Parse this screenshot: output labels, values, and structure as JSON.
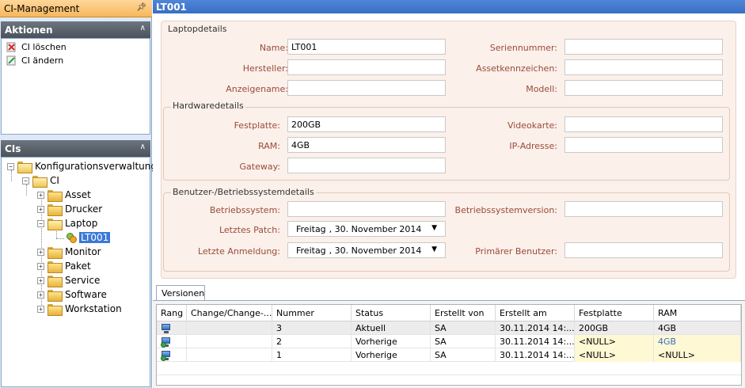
{
  "app": {
    "title": "CI-Management"
  },
  "actions_panel": {
    "title": "Aktionen",
    "items": [
      {
        "label": "CI löschen",
        "icon": "delete-icon"
      },
      {
        "label": "CI ändern",
        "icon": "edit-icon"
      }
    ]
  },
  "cis_panel": {
    "title": "CIs",
    "tree": {
      "root": "Konfigurationsverwaltung",
      "ci": "CI",
      "children": [
        "Asset",
        "Drucker",
        "Laptop",
        "Monitor",
        "Paket",
        "Service",
        "Software",
        "Workstation"
      ],
      "laptop_child": "LT001"
    }
  },
  "header": {
    "title": "LT001"
  },
  "laptopdetails": {
    "group_title": "Laptopdetails",
    "name_label": "Name:",
    "name_value": "LT001",
    "seriennummer_label": "Seriennummer:",
    "seriennummer_value": "",
    "hersteller_label": "Hersteller:",
    "hersteller_value": "",
    "assetkennzeichen_label": "Assetkennzeichen:",
    "assetkennzeichen_value": "",
    "anzeigename_label": "Anzeigename:",
    "anzeigename_value": "",
    "modell_label": "Modell:",
    "modell_value": ""
  },
  "hardwaredetails": {
    "group_title": "Hardwaredetails",
    "festplatte_label": "Festplatte:",
    "festplatte_value": "200GB",
    "videokarte_label": "Videokarte:",
    "videokarte_value": "",
    "ram_label": "RAM:",
    "ram_value": "4GB",
    "ip_label": "IP-Adresse:",
    "ip_value": "",
    "gateway_label": "Gateway:",
    "gateway_value": ""
  },
  "benutzerdetails": {
    "group_title": "Benutzer-/Betriebssystemdetails",
    "betriebssystem_label": "Betriebssystem:",
    "betriebssystem_value": "",
    "version_label": "Betriebssystemversion:",
    "version_value": "",
    "patch_label": "Letztes Patch:",
    "patch_day": "Freitag",
    "patch_date": ", 30. November 2014",
    "anmeldung_label": "Letzte Anmeldung:",
    "anmeldung_day": "Freitag",
    "anmeldung_date": ", 30. November 2014",
    "benutzer_label": "Primärer Benutzer:",
    "benutzer_value": ""
  },
  "versions": {
    "tab_label": "Versionen",
    "columns": [
      "Rang",
      "Change/Change-...",
      "Nummer",
      "Status",
      "Erstellt von",
      "Erstellt am",
      "Festplatte",
      "RAM"
    ],
    "rows": [
      {
        "nummer": "3",
        "status": "Aktuell",
        "erstellt_von": "SA",
        "erstellt_am": "30.11.2014 14:...",
        "festplatte": "200GB",
        "ram": "4GB"
      },
      {
        "nummer": "2",
        "status": "Vorherige",
        "erstellt_von": "SA",
        "erstellt_am": "30.11.2014 14:...",
        "festplatte": "<NULL>",
        "ram": "4GB"
      },
      {
        "nummer": "1",
        "status": "Vorherige",
        "erstellt_von": "SA",
        "erstellt_am": "30.11.2014 14:...",
        "festplatte": "<NULL>",
        "ram": "<NULL>"
      }
    ]
  },
  "colors": {
    "accent": "#3c78d8",
    "header_orange": "#f7b75b",
    "form_bg": "#fbf0ea",
    "label": "#9a4b3a",
    "null_bg": "#fff8d4"
  }
}
